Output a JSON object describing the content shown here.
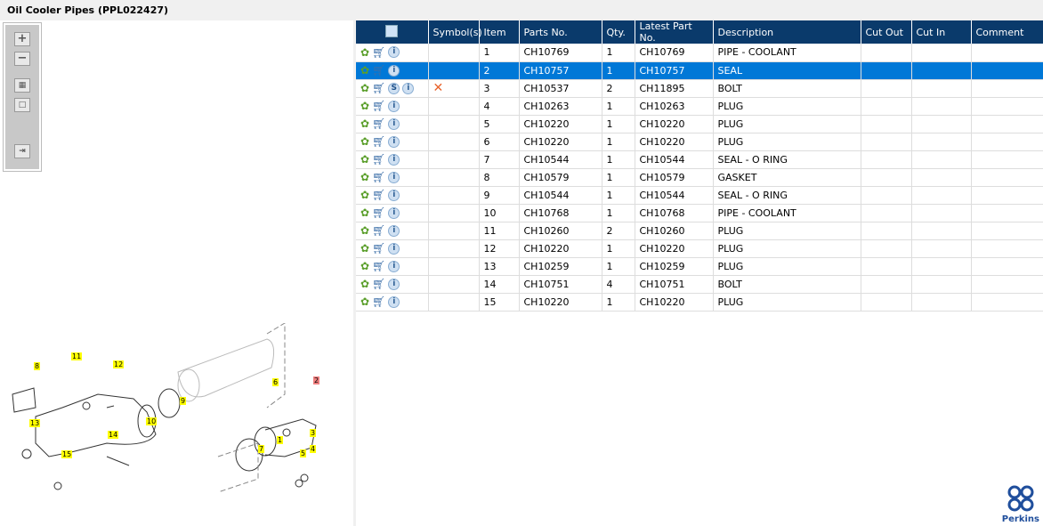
{
  "title": "Oil Cooler Pipes (PPL022427)",
  "toolbar": {
    "zoom_in": "+",
    "zoom_out": "−"
  },
  "table": {
    "columns": [
      "",
      "Symbol(s)",
      "Item",
      "Parts No.",
      "Qty.",
      "Latest Part No.",
      "Description",
      "Cut Out",
      "Cut In",
      "Comment"
    ],
    "selected_item": "2",
    "rows": [
      {
        "item": "1",
        "part": "CH10769",
        "qty": "1",
        "latest": "CH10769",
        "desc": "PIPE - COOLANT",
        "s": false,
        "x": false
      },
      {
        "item": "2",
        "part": "CH10757",
        "qty": "1",
        "latest": "CH10757",
        "desc": "SEAL",
        "s": false,
        "x": false
      },
      {
        "item": "3",
        "part": "CH10537",
        "qty": "2",
        "latest": "CH11895",
        "desc": "BOLT",
        "s": true,
        "x": true
      },
      {
        "item": "4",
        "part": "CH10263",
        "qty": "1",
        "latest": "CH10263",
        "desc": "PLUG",
        "s": false,
        "x": false
      },
      {
        "item": "5",
        "part": "CH10220",
        "qty": "1",
        "latest": "CH10220",
        "desc": "PLUG",
        "s": false,
        "x": false
      },
      {
        "item": "6",
        "part": "CH10220",
        "qty": "1",
        "latest": "CH10220",
        "desc": "PLUG",
        "s": false,
        "x": false
      },
      {
        "item": "7",
        "part": "CH10544",
        "qty": "1",
        "latest": "CH10544",
        "desc": "SEAL - O RING",
        "s": false,
        "x": false
      },
      {
        "item": "8",
        "part": "CH10579",
        "qty": "1",
        "latest": "CH10579",
        "desc": "GASKET",
        "s": false,
        "x": false
      },
      {
        "item": "9",
        "part": "CH10544",
        "qty": "1",
        "latest": "CH10544",
        "desc": "SEAL - O RING",
        "s": false,
        "x": false
      },
      {
        "item": "10",
        "part": "CH10768",
        "qty": "1",
        "latest": "CH10768",
        "desc": "PIPE - COOLANT",
        "s": false,
        "x": false
      },
      {
        "item": "11",
        "part": "CH10260",
        "qty": "2",
        "latest": "CH10260",
        "desc": "PLUG",
        "s": false,
        "x": false
      },
      {
        "item": "12",
        "part": "CH10220",
        "qty": "1",
        "latest": "CH10220",
        "desc": "PLUG",
        "s": false,
        "x": false
      },
      {
        "item": "13",
        "part": "CH10259",
        "qty": "1",
        "latest": "CH10259",
        "desc": "PLUG",
        "s": false,
        "x": false
      },
      {
        "item": "14",
        "part": "CH10751",
        "qty": "4",
        "latest": "CH10751",
        "desc": "BOLT",
        "s": false,
        "x": false
      },
      {
        "item": "15",
        "part": "CH10220",
        "qty": "1",
        "latest": "CH10220",
        "desc": "PLUG",
        "s": false,
        "x": false
      }
    ]
  },
  "callouts": [
    "11",
    "12",
    "8",
    "9",
    "10",
    "13",
    "14",
    "15",
    "6",
    "2",
    "1",
    "3",
    "4",
    "5",
    "7"
  ],
  "logo": {
    "text": "Perkins"
  },
  "colors": {
    "header": "#0a3a6b",
    "selected": "#0078d7"
  }
}
